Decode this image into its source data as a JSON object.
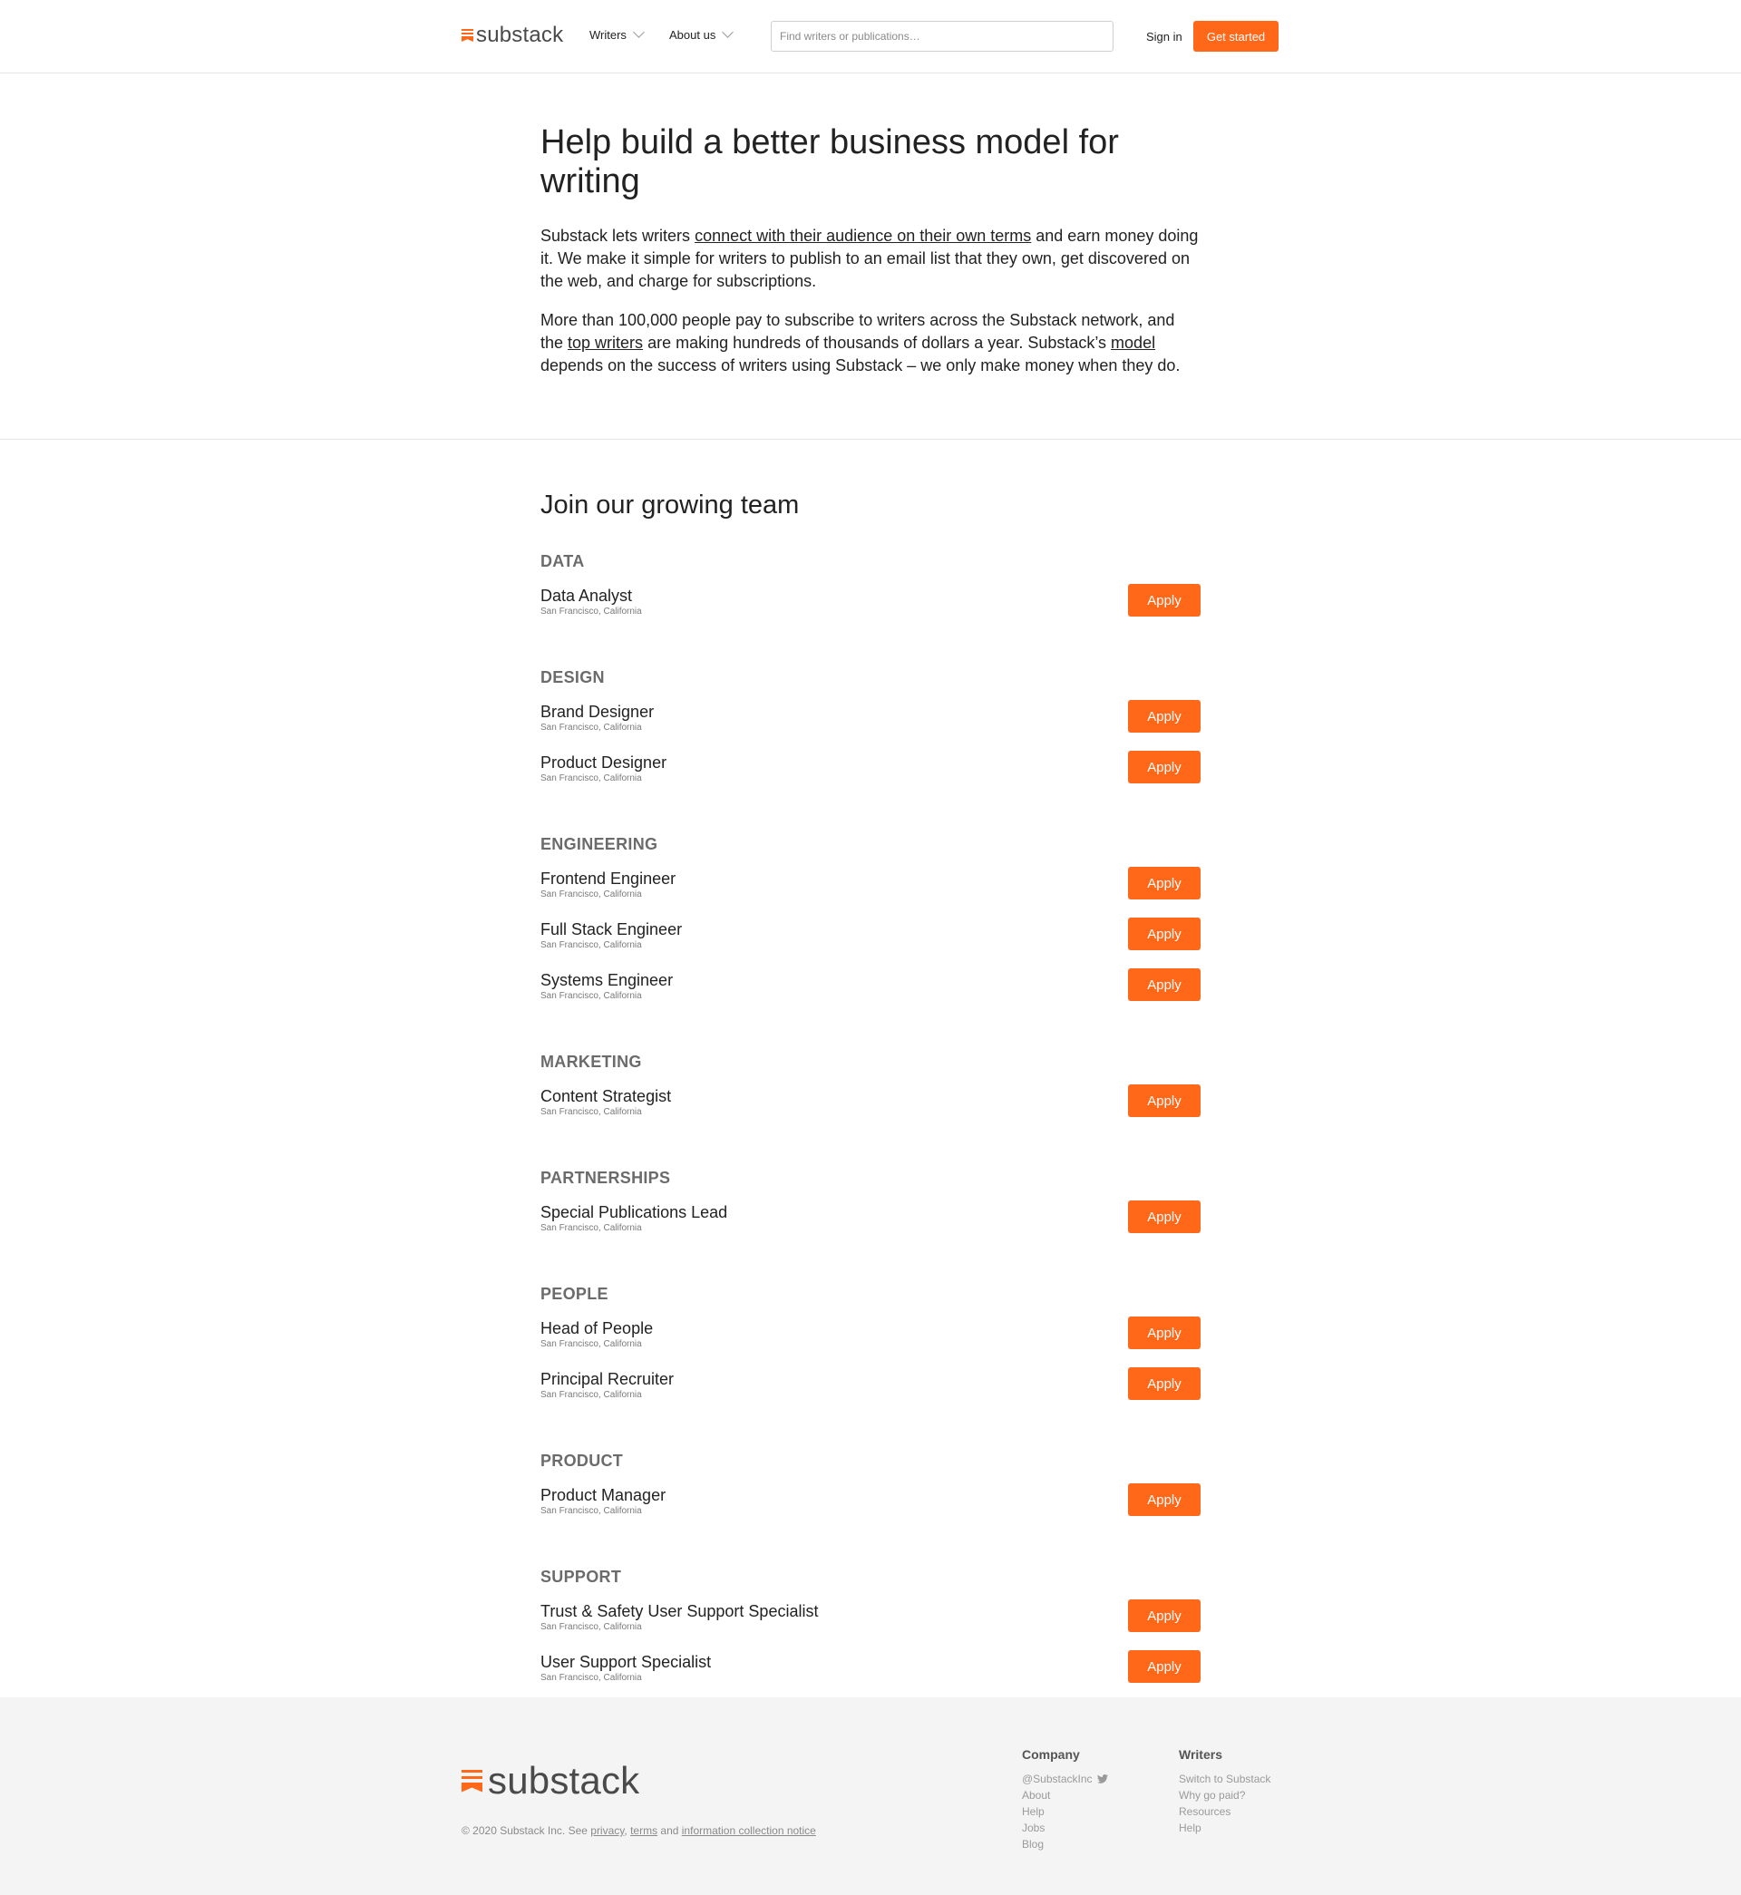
{
  "header": {
    "logo_text": "substack",
    "nav": [
      {
        "label": "Writers"
      },
      {
        "label": "About us"
      }
    ],
    "search_placeholder": "Find writers or publications…",
    "signin_label": "Sign in",
    "get_started_label": "Get started",
    "accent_color": "#ff6719"
  },
  "intro": {
    "title": "Help build a better business model for writing",
    "p1_before": "Substack lets writers ",
    "p1_link": "connect with their audience on their own terms",
    "p1_after": " and earn money doing it. We make it simple for writers to publish to an email list that they own, get discovered on the web, and charge for subscriptions.",
    "p2_before": "More than 100,000 people pay to subscribe to writers across the Substack network, and the ",
    "p2_link1": "top writers",
    "p2_middle": " are making hundreds of thousands of dollars a year. Substack’s ",
    "p2_link2": "model",
    "p2_after": " depends on the success of writers using Substack – we only make money when they do."
  },
  "jobs": {
    "heading": "Join our growing team",
    "apply_label": "Apply",
    "departments": [
      {
        "name": "DATA",
        "roles": [
          {
            "title": "Data Analyst",
            "location": "San Francisco, California"
          }
        ]
      },
      {
        "name": "DESIGN",
        "roles": [
          {
            "title": "Brand Designer",
            "location": "San Francisco, California"
          },
          {
            "title": "Product Designer",
            "location": "San Francisco, California"
          }
        ]
      },
      {
        "name": "ENGINEERING",
        "roles": [
          {
            "title": "Frontend Engineer",
            "location": "San Francisco, California"
          },
          {
            "title": "Full Stack Engineer",
            "location": "San Francisco, California"
          },
          {
            "title": "Systems Engineer",
            "location": "San Francisco, California"
          }
        ]
      },
      {
        "name": "MARKETING",
        "roles": [
          {
            "title": "Content Strategist",
            "location": "San Francisco, California"
          }
        ]
      },
      {
        "name": "PARTNERSHIPS",
        "roles": [
          {
            "title": "Special Publications Lead",
            "location": "San Francisco, California"
          }
        ]
      },
      {
        "name": "PEOPLE",
        "roles": [
          {
            "title": "Head of People",
            "location": "San Francisco, California"
          },
          {
            "title": "Principal Recruiter",
            "location": "San Francisco, California"
          }
        ]
      },
      {
        "name": "PRODUCT",
        "roles": [
          {
            "title": "Product Manager",
            "location": "San Francisco, California"
          }
        ]
      },
      {
        "name": "SUPPORT",
        "roles": [
          {
            "title": "Trust & Safety User Support Specialist",
            "location": "San Francisco, California"
          },
          {
            "title": "User Support Specialist",
            "location": "San Francisco, California"
          }
        ]
      }
    ]
  },
  "footer": {
    "logo_text": "substack",
    "copyright_before": "© 2020 Substack Inc. See ",
    "privacy": "privacy",
    "comma": ", ",
    "terms": "terms",
    "and": " and ",
    "notice": "information collection notice",
    "columns": [
      {
        "heading": "Company",
        "links": [
          "@SubstackInc",
          "About",
          "Help",
          "Jobs",
          "Blog"
        ]
      },
      {
        "heading": "Writers",
        "links": [
          "Switch to Substack",
          "Why go paid?",
          "Resources",
          "Help"
        ]
      }
    ]
  }
}
